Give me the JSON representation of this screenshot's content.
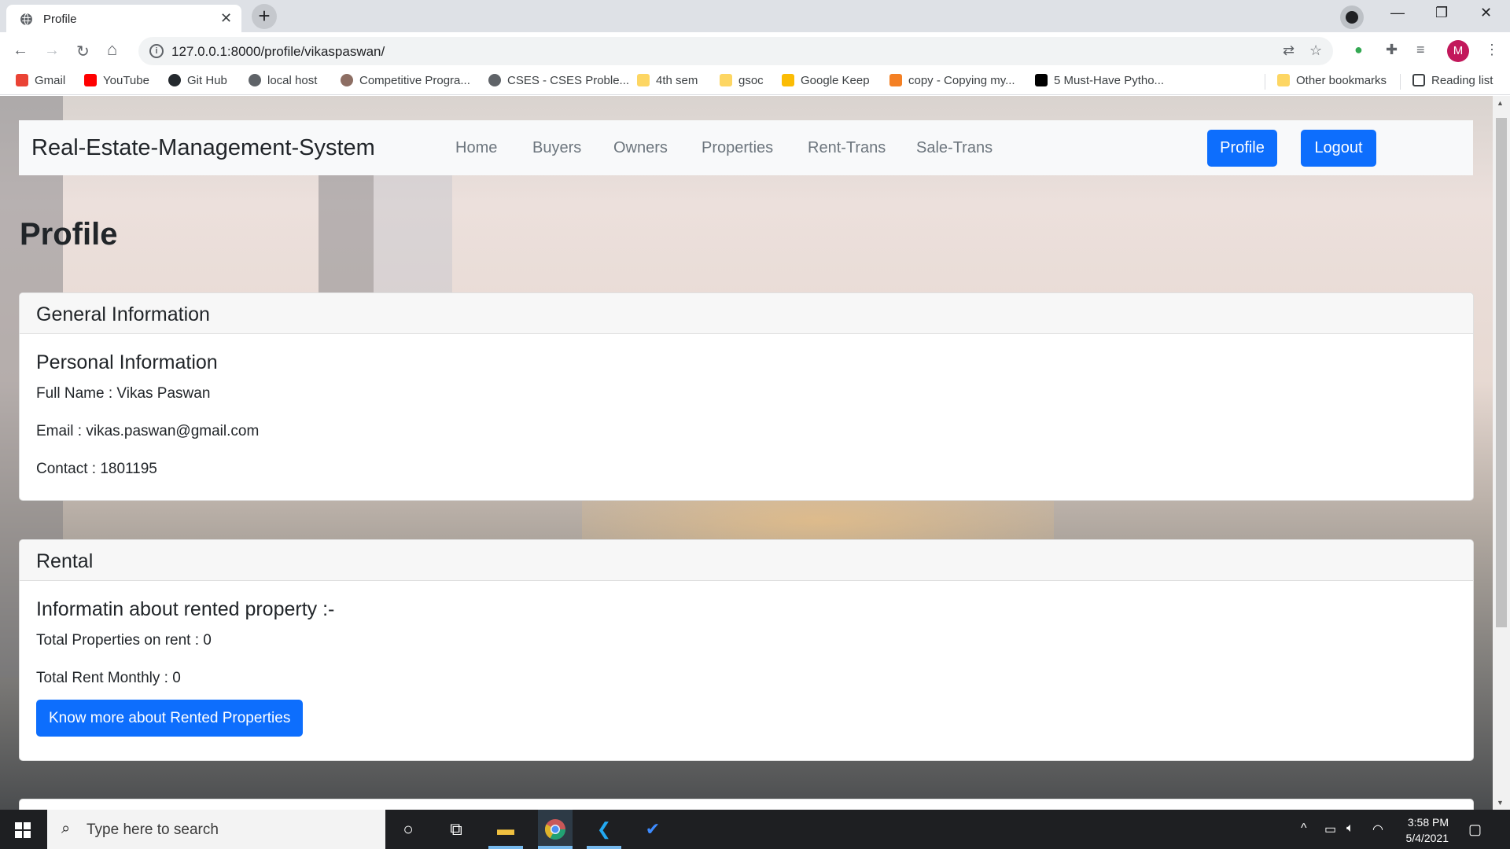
{
  "browser": {
    "tab_title": "Profile",
    "tab_close": "✕",
    "new_tab": "+",
    "url": "127.0.0.1:8000/profile/vikaspaswan/",
    "avatar_letter": "M",
    "controls": {
      "minimize": "—",
      "restore": "❐",
      "close": "✕"
    },
    "nav": {
      "back": "←",
      "forward": "→",
      "reload": "↻",
      "home": "⌂"
    }
  },
  "bookmarks": [
    {
      "label": "Gmail",
      "icon": "gmail-icon",
      "color": "#ea4335"
    },
    {
      "label": "YouTube",
      "icon": "youtube-icon",
      "color": "#ff0000"
    },
    {
      "label": "Git Hub",
      "icon": "github-icon",
      "color": "#24292e"
    },
    {
      "label": "local host",
      "icon": "globe-icon",
      "color": "#5f6368"
    },
    {
      "label": "Competitive Progra...",
      "icon": "site-icon",
      "color": "#8d6e63"
    },
    {
      "label": "CSES - CSES Proble...",
      "icon": "globe-icon",
      "color": "#5f6368"
    },
    {
      "label": "4th sem",
      "icon": "folder-icon",
      "color": "#fdd663"
    },
    {
      "label": "gsoc",
      "icon": "folder-icon",
      "color": "#fdd663"
    },
    {
      "label": "Google Keep",
      "icon": "keep-icon",
      "color": "#fbbc04"
    },
    {
      "label": "copy - Copying my...",
      "icon": "stackoverflow-icon",
      "color": "#f48024"
    },
    {
      "label": "5 Must-Have Pytho...",
      "icon": "medium-icon",
      "color": "#000000"
    }
  ],
  "bookmarks_right": {
    "other": "Other bookmarks",
    "reading": "Reading list"
  },
  "site": {
    "brand": "Real-Estate-Management-System",
    "nav": [
      "Home",
      "Buyers",
      "Owners",
      "Properties",
      "Rent-Trans",
      "Sale-Trans"
    ],
    "profile_button": "Profile",
    "logout_button": "Logout",
    "accent": "#0d6efd"
  },
  "page": {
    "title": "Profile",
    "general": {
      "header": "General Information",
      "subtitle": "Personal Information",
      "full_name": "Full Name : Vikas Paswan",
      "email": "Email : vikas.paswan@gmail.com",
      "contact": "Contact : 1801195"
    },
    "rental": {
      "header": "Rental",
      "subtitle": "Informatin about rented property :-",
      "total_properties": "Total Properties on rent : 0",
      "total_rent": "Total Rent Monthly : 0",
      "button": "Know more about Rented Properties"
    }
  },
  "taskbar": {
    "search_placeholder": "Type here to search",
    "time": "3:58 PM",
    "date": "5/4/2021"
  }
}
